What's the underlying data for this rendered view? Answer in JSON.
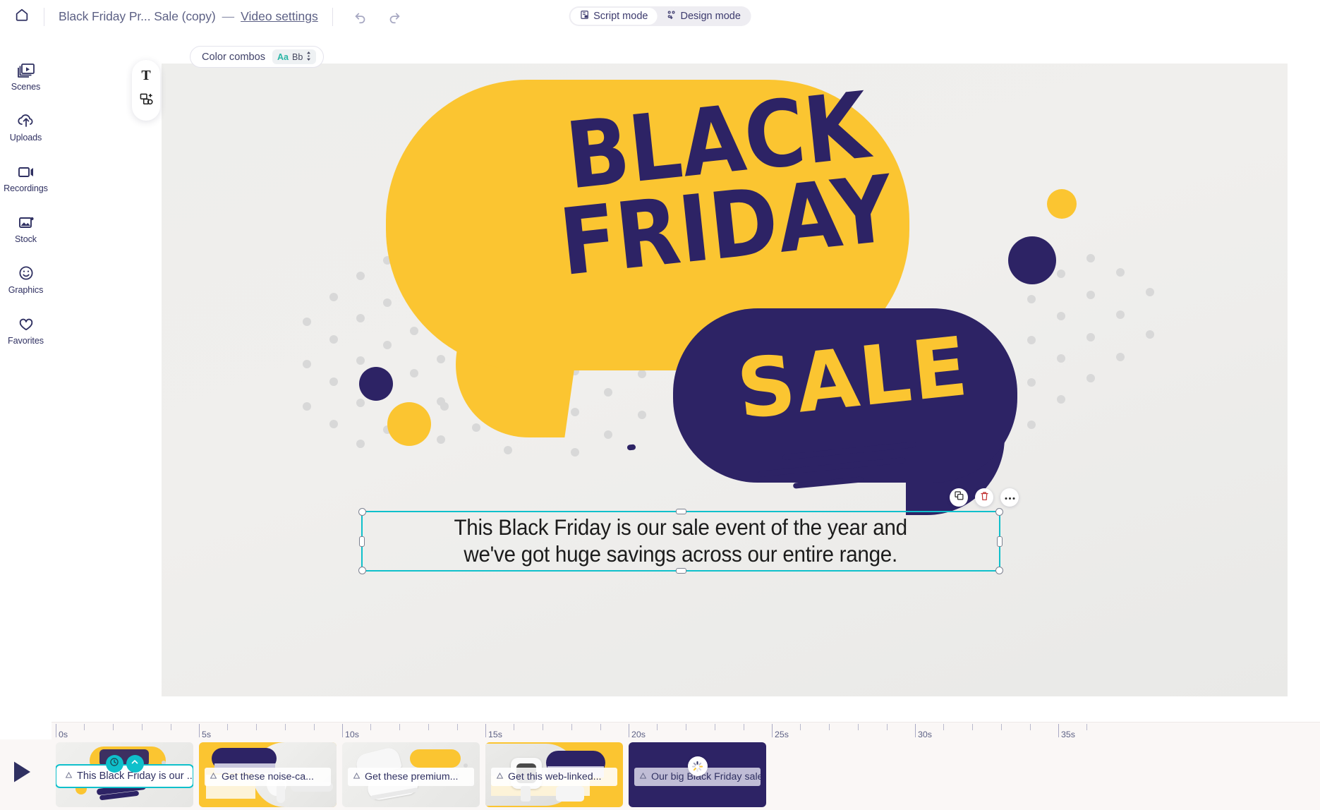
{
  "header": {
    "home_icon": "home-icon",
    "doc_title": "Black Friday Pr... Sale (copy)",
    "title_dash": "—",
    "video_settings": "Video settings",
    "undo_icon": "undo-icon",
    "redo_icon": "redo-icon",
    "modes": [
      {
        "label": "Script mode",
        "icon": "script-mode-icon",
        "active": true
      },
      {
        "label": "Design mode",
        "icon": "design-mode-icon",
        "active": false
      }
    ]
  },
  "sidebar": {
    "items": [
      {
        "label": "Scenes",
        "icon": "scenes-icon"
      },
      {
        "label": "Uploads",
        "icon": "upload-cloud-icon"
      },
      {
        "label": "Recordings",
        "icon": "video-camera-icon"
      },
      {
        "label": "Stock",
        "icon": "image-icon"
      },
      {
        "label": "Graphics",
        "icon": "smiley-icon"
      },
      {
        "label": "Favorites",
        "icon": "heart-icon"
      }
    ]
  },
  "toolbar": {
    "color_combos_label": "Color combos",
    "swatch_aa": "Aa",
    "swatch_bb": "Bb",
    "swatch_stepper_icon": "stepper-updown-icon"
  },
  "tools": [
    {
      "name": "text-tool",
      "glyph": "T"
    },
    {
      "name": "shapes-tool",
      "icon": "shapes-icon"
    }
  ],
  "canvas": {
    "artwork": {
      "headline_line1": "BLACK",
      "headline_line2": "FRIDAY",
      "badge": "SALE",
      "yellow": "#fbc531",
      "navy": "#2d2365",
      "background": "#efefed",
      "dot_color": "#d8d8d8"
    },
    "selected_text": {
      "line1": "This Black Friday is our sale event of the year and",
      "line2": "we've got huge savings across our entire range.",
      "selection_color": "#0fc0cb"
    },
    "actions": [
      {
        "name": "duplicate-button",
        "icon": "duplicate-icon"
      },
      {
        "name": "delete-button",
        "icon": "trash-icon",
        "color": "#d03030"
      },
      {
        "name": "more-options-button",
        "icon": "ellipsis-icon"
      }
    ]
  },
  "timeline": {
    "total_duration": "26s",
    "play_icon": "play-icon",
    "ticks": [
      "0s",
      "5s",
      "10s",
      "15s",
      "20s",
      "25s",
      "30s",
      "35s"
    ],
    "scenes": [
      {
        "caption": "This Black Friday is our ...",
        "selected": true,
        "style": "black-friday",
        "controls": [
          {
            "name": "scene-timing-button",
            "icon": "clock-icon"
          },
          {
            "name": "scene-collapse-button",
            "icon": "chevron-up-icon"
          }
        ]
      },
      {
        "caption": "Get these noise-ca...",
        "selected": false,
        "style": "earbuds"
      },
      {
        "caption": "Get these premium...",
        "selected": false,
        "style": "sneakers"
      },
      {
        "caption": "Get this web-linked...",
        "selected": false,
        "style": "watch"
      },
      {
        "caption": "Our big Black Friday sale ...",
        "selected": false,
        "style": "navy",
        "loading": true
      }
    ]
  }
}
